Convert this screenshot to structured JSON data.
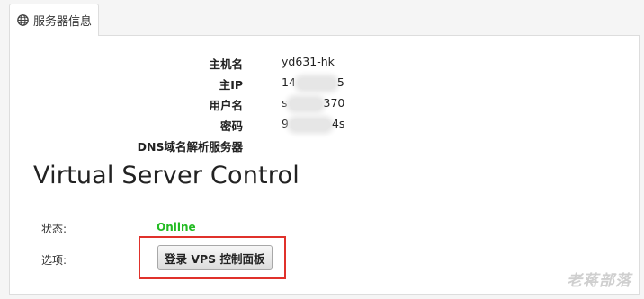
{
  "tab": {
    "label": "服务器信息",
    "icon": "globe-icon"
  },
  "server_info": [
    {
      "label": "主机名",
      "value": "yd631-hk"
    },
    {
      "label": "主IP",
      "value_prefix": "14",
      "value_suffix": "5"
    },
    {
      "label": "用户名",
      "value_prefix": "s",
      "value_suffix": "370"
    },
    {
      "label": "密码",
      "value_prefix": "9",
      "value_suffix": "4s"
    },
    {
      "label": "DNS域名解析服务器",
      "value": ""
    }
  ],
  "vps": {
    "title": "Virtual Server Control",
    "status_label": "状态:",
    "status_value": "Online",
    "options_label": "选项:",
    "login_button": "登录 VPS 控制面板"
  },
  "watermark": "老蒋部落",
  "colors": {
    "status_online": "#22bb22",
    "highlight_box": "#e0312b"
  }
}
